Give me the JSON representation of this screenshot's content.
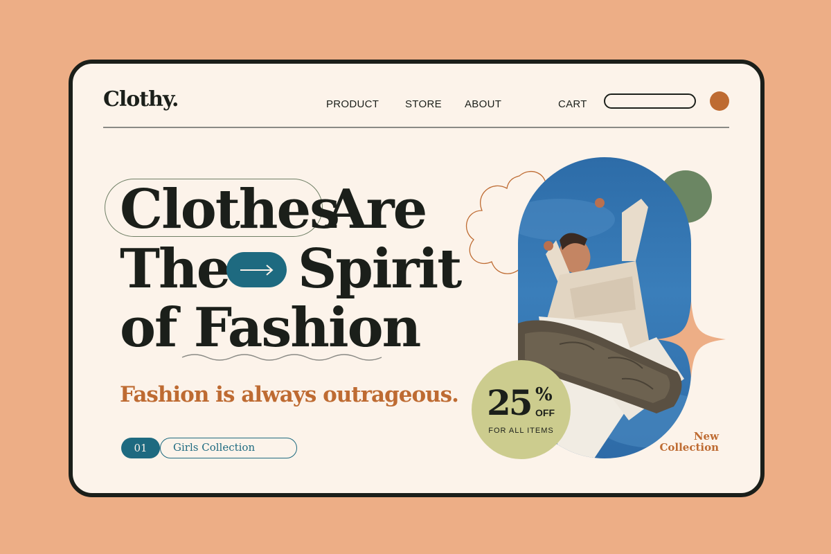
{
  "header": {
    "logo": "Clothy.",
    "nav": [
      "PRODUCT",
      "STORE",
      "ABOUT"
    ],
    "cart": "CART",
    "search_placeholder": ""
  },
  "hero": {
    "line1_word1": "Clothes",
    "line1_word2": "Are",
    "line2_word1": "The",
    "line2_word2": "Spirit",
    "line3": "of Fashion",
    "tagline": "Fashion is always outrageous.",
    "collection_number": "01",
    "collection_label": "Girls Collection"
  },
  "promo": {
    "percent": "25",
    "percent_sign": "%",
    "off": "OFF",
    "subtext": "FOR ALL ITEMS",
    "new_line1": "New",
    "new_line2": "Collection"
  },
  "colors": {
    "background": "#EDAE86",
    "card": "#FCF3EA",
    "ink": "#1B1F1A",
    "accent_teal": "#1E6A80",
    "accent_orange": "#BE6B32",
    "green": "#6B8663",
    "badge": "#CCCC8E"
  },
  "icons": [
    "arrow-right-icon",
    "flower-outline-icon",
    "sparkle-icon"
  ]
}
